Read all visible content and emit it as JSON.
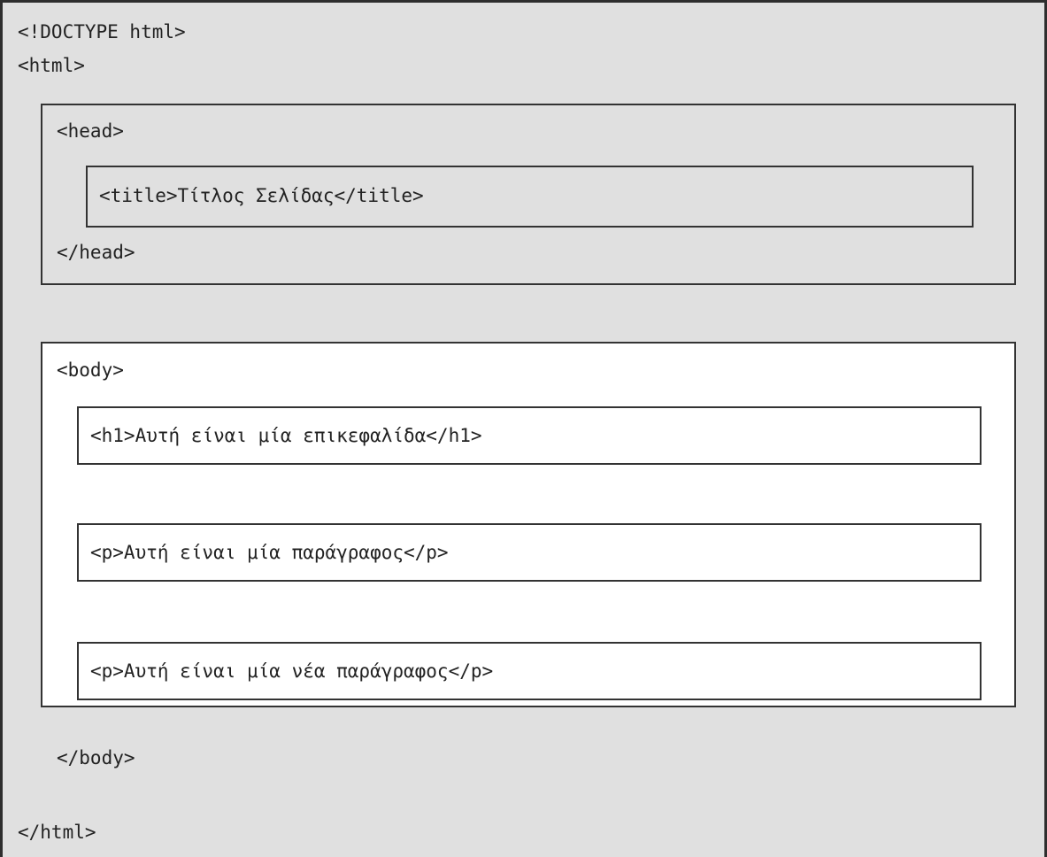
{
  "doctype": "<!DOCTYPE html>",
  "html_open": "<html>",
  "head_open": "<head>",
  "title_line": "<title>Τίτλος Σελίδας</title>",
  "head_close": "</head>",
  "body_open": "<body>",
  "h1_line": "<h1>Αυτή είναι μία επικεφαλίδα</h1>",
  "p1_line": "<p>Αυτή είναι μία παράγραφος</p>",
  "p2_line": "<p>Αυτή είναι μία νέα παράγραφος</p>",
  "body_close": "</body>",
  "html_close": "</html>",
  "colors": {
    "frame_background": "#e0e0e0",
    "body_background": "#ffffff",
    "border": "#333333",
    "text": "#222222"
  }
}
